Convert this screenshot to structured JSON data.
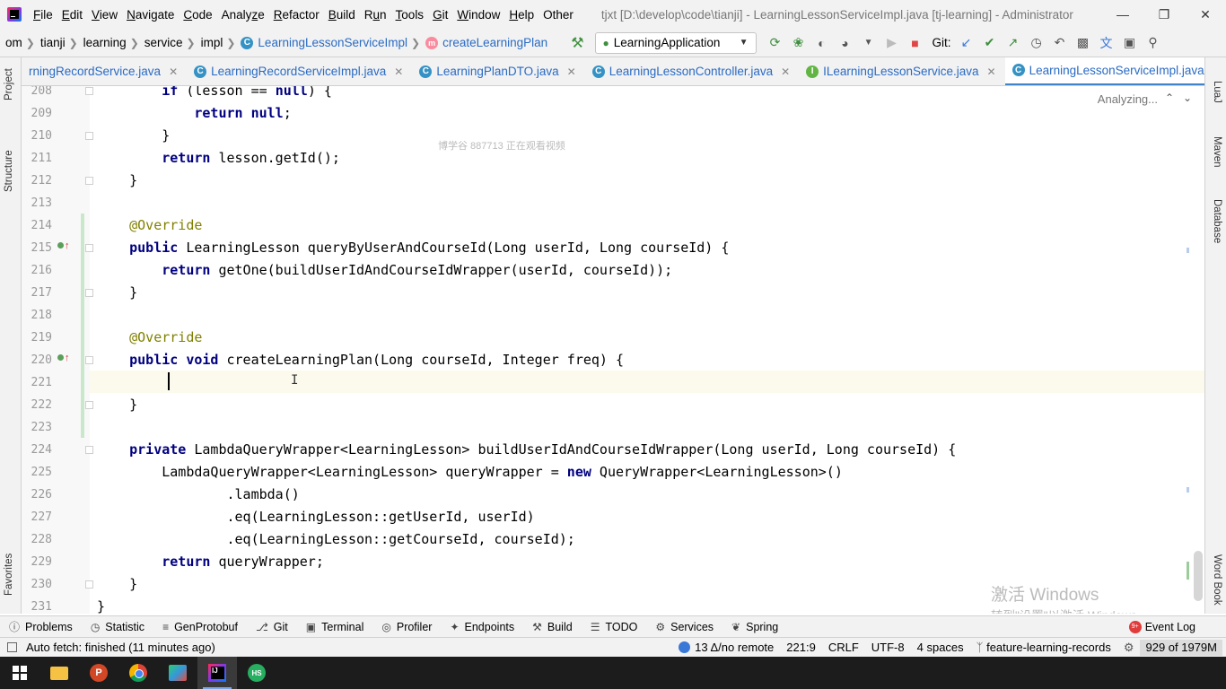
{
  "menu": {
    "items": [
      {
        "label": "File",
        "hotkey": "F"
      },
      {
        "label": "Edit",
        "hotkey": "E"
      },
      {
        "label": "View",
        "hotkey": "V"
      },
      {
        "label": "Navigate",
        "hotkey": "N"
      },
      {
        "label": "Code",
        "hotkey": "C"
      },
      {
        "label": "Analyze",
        "hotkey": "z"
      },
      {
        "label": "Refactor",
        "hotkey": "R"
      },
      {
        "label": "Build",
        "hotkey": "B"
      },
      {
        "label": "Run",
        "hotkey": "u"
      },
      {
        "label": "Tools",
        "hotkey": "T"
      },
      {
        "label": "Git",
        "hotkey": "G"
      },
      {
        "label": "Window",
        "hotkey": "W"
      },
      {
        "label": "Help",
        "hotkey": "H"
      },
      {
        "label": "Other",
        "hotkey": ""
      }
    ],
    "window_title": "tjxt [D:\\develop\\code\\tianji] - LearningLessonServiceImpl.java [tj-learning] - Administrator"
  },
  "navbar": {
    "crumbs": [
      "om",
      "tianji",
      "learning",
      "service",
      "impl"
    ],
    "class_crumb": "LearningLessonServiceImpl",
    "method_crumb": "createLearningPlan",
    "run_config": "LearningApplication",
    "git_label": "Git:"
  },
  "tabs": [
    {
      "label": "rningRecordService.java",
      "kind": "iface-partial",
      "active": false
    },
    {
      "label": "LearningRecordServiceImpl.java",
      "kind": "class",
      "active": false
    },
    {
      "label": "LearningPlanDTO.java",
      "kind": "class",
      "active": false
    },
    {
      "label": "LearningLessonController.java",
      "kind": "class",
      "active": false
    },
    {
      "label": "ILearningLessonService.java",
      "kind": "iface",
      "active": false
    },
    {
      "label": "LearningLessonServiceImpl.java",
      "kind": "class",
      "active": true
    }
  ],
  "editor": {
    "analyzing": "Analyzing...",
    "watermark": "博学谷 887713 正在观看视频",
    "lines": [
      {
        "n": "208",
        "code": [
          [
            "",
            "        "
          ],
          [
            "kw",
            "if"
          ],
          [
            "",
            " (lesson == "
          ],
          [
            "kw",
            "null"
          ],
          [
            "",
            ") {"
          ]
        ]
      },
      {
        "n": "209",
        "code": [
          [
            "",
            "            "
          ],
          [
            "kw",
            "return null"
          ],
          [
            "",
            ";"
          ]
        ]
      },
      {
        "n": "210",
        "code": [
          [
            "",
            "        }"
          ]
        ]
      },
      {
        "n": "211",
        "code": [
          [
            "",
            "        "
          ],
          [
            "kw",
            "return"
          ],
          [
            "",
            " lesson.getId();"
          ]
        ]
      },
      {
        "n": "212",
        "code": [
          [
            "",
            "    }"
          ]
        ]
      },
      {
        "n": "213",
        "code": [
          [
            "",
            ""
          ]
        ]
      },
      {
        "n": "214",
        "code": [
          [
            "ann",
            "    @Override"
          ]
        ]
      },
      {
        "n": "215",
        "code": [
          [
            "",
            "    "
          ],
          [
            "kw",
            "public"
          ],
          [
            "",
            " LearningLesson queryByUserAndCourseId(Long userId, Long courseId) {"
          ]
        ]
      },
      {
        "n": "216",
        "code": [
          [
            "",
            "        "
          ],
          [
            "kw",
            "return"
          ],
          [
            "",
            " getOne(buildUserIdAndCourseIdWrapper(userId, courseId));"
          ]
        ]
      },
      {
        "n": "217",
        "code": [
          [
            "",
            "    }"
          ]
        ]
      },
      {
        "n": "218",
        "code": [
          [
            "",
            ""
          ]
        ]
      },
      {
        "n": "219",
        "code": [
          [
            "ann",
            "    @Override"
          ]
        ]
      },
      {
        "n": "220",
        "code": [
          [
            "",
            "    "
          ],
          [
            "kw",
            "public void"
          ],
          [
            "",
            " createLearningPlan(Long courseId, Integer freq) {"
          ]
        ]
      },
      {
        "n": "221",
        "code": [
          [
            "",
            ""
          ]
        ]
      },
      {
        "n": "222",
        "code": [
          [
            "",
            "    }"
          ]
        ]
      },
      {
        "n": "223",
        "code": [
          [
            "",
            ""
          ]
        ]
      },
      {
        "n": "224",
        "code": [
          [
            "",
            "    "
          ],
          [
            "kw",
            "private"
          ],
          [
            "",
            " LambdaQueryWrapper<LearningLesson> buildUserIdAndCourseIdWrapper(Long userId, Long courseId) {"
          ]
        ]
      },
      {
        "n": "225",
        "code": [
          [
            "",
            "        LambdaQueryWrapper<LearningLesson> queryWrapper = "
          ],
          [
            "kw",
            "new"
          ],
          [
            "",
            " QueryWrapper<LearningLesson>()"
          ]
        ]
      },
      {
        "n": "226",
        "code": [
          [
            "",
            "                .lambda()"
          ]
        ]
      },
      {
        "n": "227",
        "code": [
          [
            "",
            "                .eq(LearningLesson::getUserId, userId)"
          ]
        ]
      },
      {
        "n": "228",
        "code": [
          [
            "",
            "                .eq(LearningLesson::getCourseId, courseId);"
          ]
        ]
      },
      {
        "n": "229",
        "code": [
          [
            "",
            "        "
          ],
          [
            "kw",
            "return"
          ],
          [
            "",
            " queryWrapper;"
          ]
        ]
      },
      {
        "n": "230",
        "code": [
          [
            "",
            "    }"
          ]
        ]
      },
      {
        "n": "231",
        "code": [
          [
            "",
            "}"
          ]
        ]
      }
    ],
    "activate_title": "激活 Windows",
    "activate_sub": "转到\"设置\"以激活 Windows。"
  },
  "left_strip": {
    "project": "Project",
    "structure": "Structure",
    "favorites": "Favorites"
  },
  "right_strip": {
    "luaj": "LuaJ",
    "maven": "Maven",
    "database": "Database",
    "wordbook": "Word Book"
  },
  "tool_windows": [
    "Problems",
    "Statistic",
    "GenProtobuf",
    "Git",
    "Terminal",
    "Profiler",
    "Endpoints",
    "Build",
    "TODO",
    "Services",
    "Spring"
  ],
  "event_log": {
    "label": "Event Log",
    "badge": "9+"
  },
  "status": {
    "message": "Auto fetch: finished (11 minutes ago)",
    "git_changes": "13 Δ/no remote",
    "position": "221:9",
    "line_sep": "CRLF",
    "encoding": "UTF-8",
    "indent": "4 spaces",
    "branch": "feature-learning-records",
    "memory": "929 of 1979M"
  },
  "taskbar": {
    "ppt_letter": "P",
    "hs_label": "HS"
  }
}
